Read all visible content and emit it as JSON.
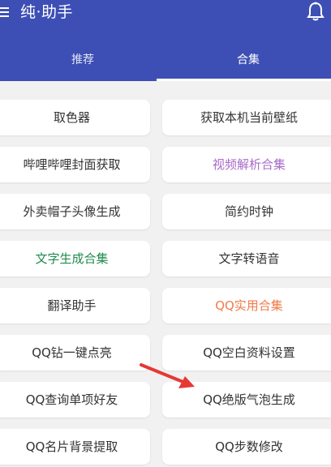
{
  "app": {
    "title": "纯·助手"
  },
  "tabs": [
    {
      "label": "推荐"
    },
    {
      "label": "合集"
    }
  ],
  "colors": {
    "primary": "#3d4fb5",
    "green_text": "#1f8a4c",
    "purple_text": "#a86bc8",
    "orange_text": "#f07b4a",
    "arrow": "#e53935"
  },
  "tools": [
    {
      "label": "取色器",
      "color": "#333333"
    },
    {
      "label": "获取本机当前壁纸",
      "color": "#333333"
    },
    {
      "label": "哔哩哔哩封面获取",
      "color": "#333333"
    },
    {
      "label": "视频解析合集",
      "color": "#a86bc8"
    },
    {
      "label": "外卖帽子头像生成",
      "color": "#333333"
    },
    {
      "label": "简约时钟",
      "color": "#333333"
    },
    {
      "label": "文字生成合集",
      "color": "#1f8a4c"
    },
    {
      "label": "文字转语音",
      "color": "#333333"
    },
    {
      "label": "翻译助手",
      "color": "#333333"
    },
    {
      "label": "QQ实用合集",
      "color": "#f07b4a"
    },
    {
      "label": "QQ钻一键点亮",
      "color": "#333333"
    },
    {
      "label": "QQ空白资料设置",
      "color": "#333333"
    },
    {
      "label": "QQ查询单项好友",
      "color": "#333333"
    },
    {
      "label": "QQ绝版气泡生成",
      "color": "#333333"
    },
    {
      "label": "QQ名片背景提取",
      "color": "#333333"
    },
    {
      "label": "QQ步数修改",
      "color": "#333333"
    }
  ]
}
